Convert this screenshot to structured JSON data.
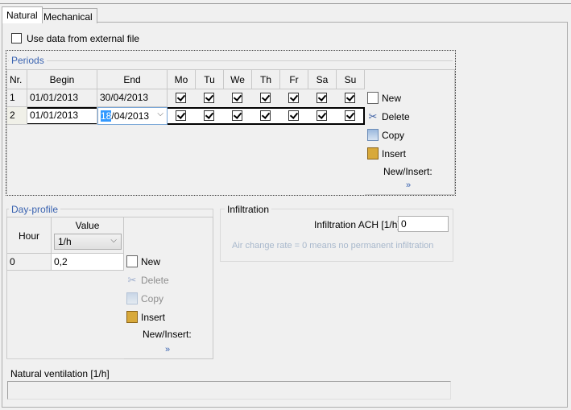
{
  "tabs": [
    {
      "label": "Natural",
      "active": true
    },
    {
      "label": "Mechanical",
      "active": false
    }
  ],
  "external_file": {
    "label": "Use data from external file",
    "checked": false
  },
  "periods": {
    "legend": "Periods",
    "columns": [
      "Nr.",
      "Begin",
      "End",
      "Mo",
      "Tu",
      "We",
      "Th",
      "Fr",
      "Sa",
      "Su"
    ],
    "rows": [
      {
        "nr": "1",
        "begin": "01/01/2013",
        "end": "30/04/2013",
        "days": [
          true,
          true,
          true,
          true,
          true,
          true,
          true
        ]
      },
      {
        "nr": "2",
        "begin": "01/01/2013",
        "end_selected": "18",
        "end_rest": "/04/2013",
        "days": [
          true,
          true,
          true,
          true,
          true,
          true,
          true
        ]
      }
    ],
    "actions": {
      "new": "New",
      "delete": "Delete",
      "copy": "Copy",
      "insert": "Insert",
      "new_insert": "New/Insert:",
      "more": "»"
    }
  },
  "day_profile": {
    "legend": "Day-profile",
    "col_hour": "Hour",
    "col_value": "Value",
    "unit": "1/h",
    "rows": [
      {
        "hour": "0",
        "value": "0,2"
      }
    ],
    "actions": {
      "new": "New",
      "delete": "Delete",
      "copy": "Copy",
      "insert": "Insert",
      "new_insert": "New/Insert:",
      "more": "»"
    }
  },
  "infiltration": {
    "legend": "Infiltration",
    "label": "Infiltration ACH  [1/h]",
    "value": "0",
    "hint": "Air change rate = 0 means no permanent infiltration"
  },
  "natural_ventilation": {
    "label": "Natural ventilation [1/h]",
    "value": ""
  }
}
